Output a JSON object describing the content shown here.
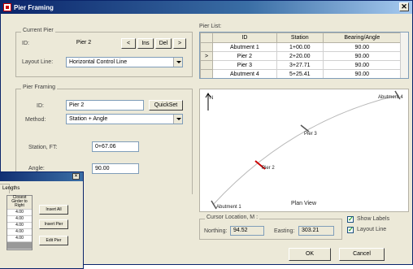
{
  "window": {
    "title": "Pier Framing",
    "close_glyph": "✕"
  },
  "current_pier": {
    "group_label": "Current Pier",
    "id_label": "ID:",
    "id_value": "Pier 2",
    "prev_label": "<",
    "ins_label": "Ins",
    "del_label": "Del",
    "next_label": ">",
    "layout_line_label": "Layout Line:",
    "layout_line_value": "Horizontal Control Line"
  },
  "pier_framing": {
    "group_label": "Pier Framing",
    "id_label": "ID:",
    "id_value": "Pier 2",
    "quickset_label": "QuickSet",
    "method_label": "Method:",
    "method_value": "Station + Angle",
    "station_label": "Station, FT:",
    "station_value": "0+67.06",
    "angle_label": "Angle:",
    "angle_value": "90.00"
  },
  "pier_list": {
    "label": "Pier List:",
    "columns": [
      "ID",
      "Station",
      "Bearing/Angle"
    ],
    "rows": [
      {
        "marker": "",
        "id": "Abutment 1",
        "station": "1+00.00",
        "angle": "90.00"
      },
      {
        "marker": ">",
        "id": "Pier 2",
        "station": "2+20.00",
        "angle": "90.00"
      },
      {
        "marker": "",
        "id": "Pier 3",
        "station": "3+27.71",
        "angle": "90.00"
      },
      {
        "marker": "",
        "id": "Abutment 4",
        "station": "5+25.41",
        "angle": "90.00"
      }
    ]
  },
  "plan_view": {
    "caption": "Plan View",
    "north_label": "N",
    "labels": {
      "abut1": "Abutment 1",
      "pier2": "Pier 2",
      "pier3": "Pier 3",
      "abut4": "Abutment 4"
    }
  },
  "cursor": {
    "group_label": "Cursor Location, M :",
    "northing_label": "Northing:",
    "northing_value": "94.52",
    "easting_label": "Easting:",
    "easting_value": "303.21"
  },
  "options": {
    "show_labels": "Show Labels",
    "layout_line": "Layout Line",
    "show_labels_checked": true,
    "layout_line_checked": true
  },
  "footer": {
    "ok_label": "OK",
    "cancel_label": "Cancel"
  },
  "popup": {
    "tab_label": "Lengths",
    "header": "Closest Girder to Right",
    "values": [
      "4.00",
      "4.00",
      "4.00",
      "4.00",
      "4.00"
    ],
    "insert_all": "Insert All",
    "insert_pier": "Insert Pier",
    "edit_pier": "Edit Pier"
  },
  "colors": {
    "title_bar": "#0a246a",
    "pier_marker": "#cc0000",
    "face": "#ece9d8"
  }
}
